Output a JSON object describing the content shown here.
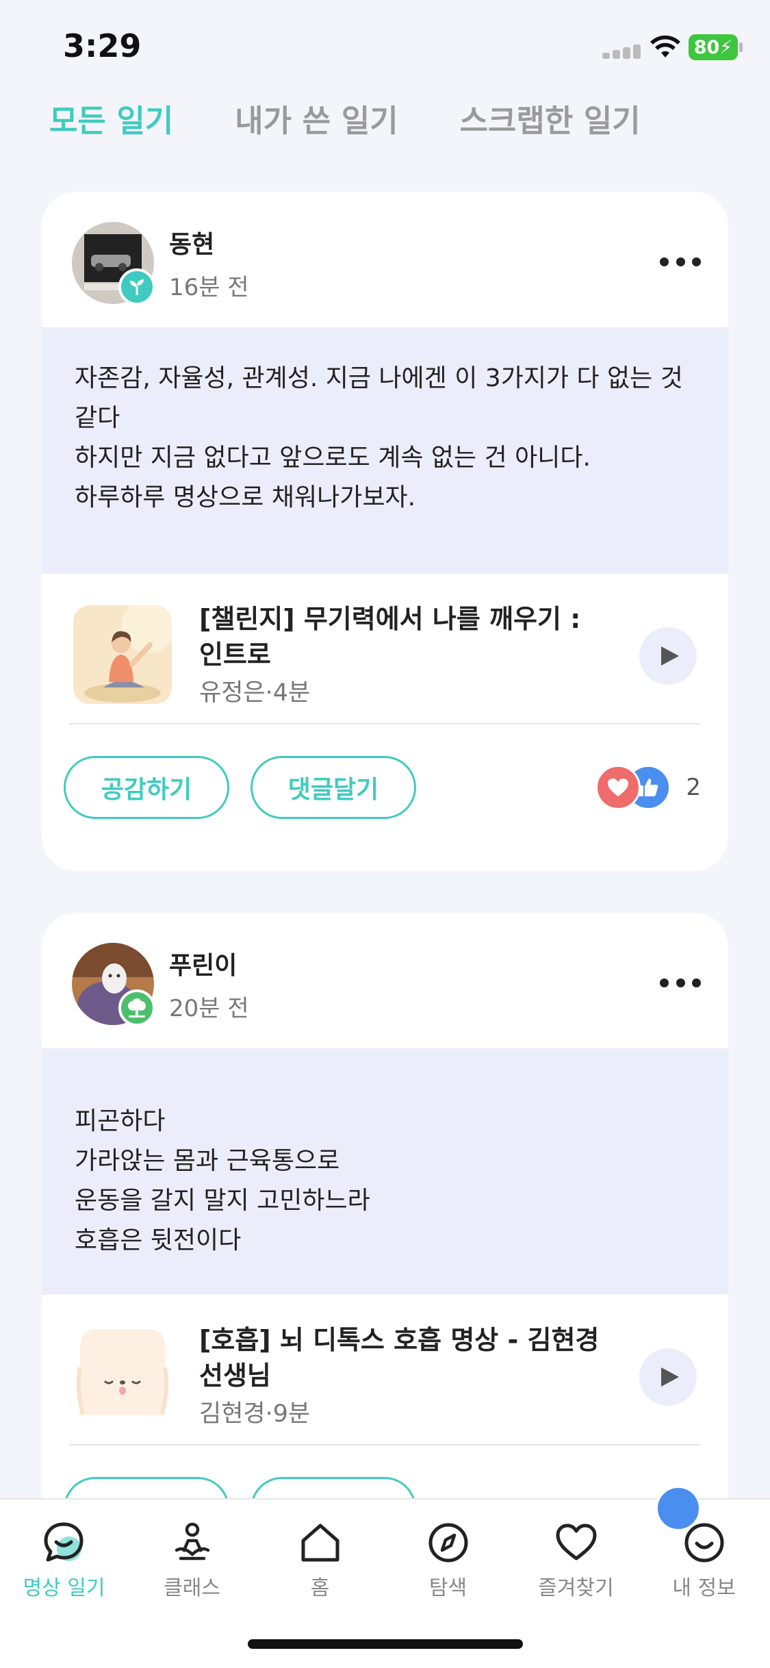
{
  "status": {
    "time": "3:29",
    "battery": "80"
  },
  "tabs": [
    {
      "label": "모든 일기"
    },
    {
      "label": "내가 쓴 일기"
    },
    {
      "label": "스크랩한 일기"
    }
  ],
  "posts": [
    {
      "author": "동현",
      "time": "16분 전",
      "text": "자존감, 자율성, 관계성. 지금 나에겐 이 3가지가 다 없는 것 같다\n하지만 지금 없다고 앞으로도 계속 없는 건 아니다.\n하루하루 명상으로 채워나가보자.",
      "content": {
        "title": "[챌린지] 무기력에서 나를 깨우기 : 인트로",
        "meta": "유정은·4분"
      },
      "actions": {
        "empathize": "공감하기",
        "comment": "댓글달기"
      },
      "reaction_count": "2"
    },
    {
      "author": "푸린이",
      "time": "20분 전",
      "text": "피곤하다\n가라앉는 몸과 근육통으로\n운동을 갈지 말지 고민하느라\n호흡은 뒷전이다",
      "content": {
        "title": "[호흡] 뇌 디톡스 호흡 명상 - 김현경 선생님",
        "meta": "김현경·9분"
      }
    }
  ],
  "nav": [
    {
      "label": "명상 일기",
      "icon": "chat-icon"
    },
    {
      "label": "클래스",
      "icon": "meditation-icon"
    },
    {
      "label": "홈",
      "icon": "home-icon"
    },
    {
      "label": "탐색",
      "icon": "compass-icon"
    },
    {
      "label": "즐겨찾기",
      "icon": "heart-icon"
    },
    {
      "label": "내 정보",
      "icon": "smile-icon"
    }
  ],
  "colors": {
    "accent": "#3fcbc0",
    "body_bg": "#ecedfb",
    "heart": "#f06b6b",
    "like": "#4a8ef0"
  }
}
